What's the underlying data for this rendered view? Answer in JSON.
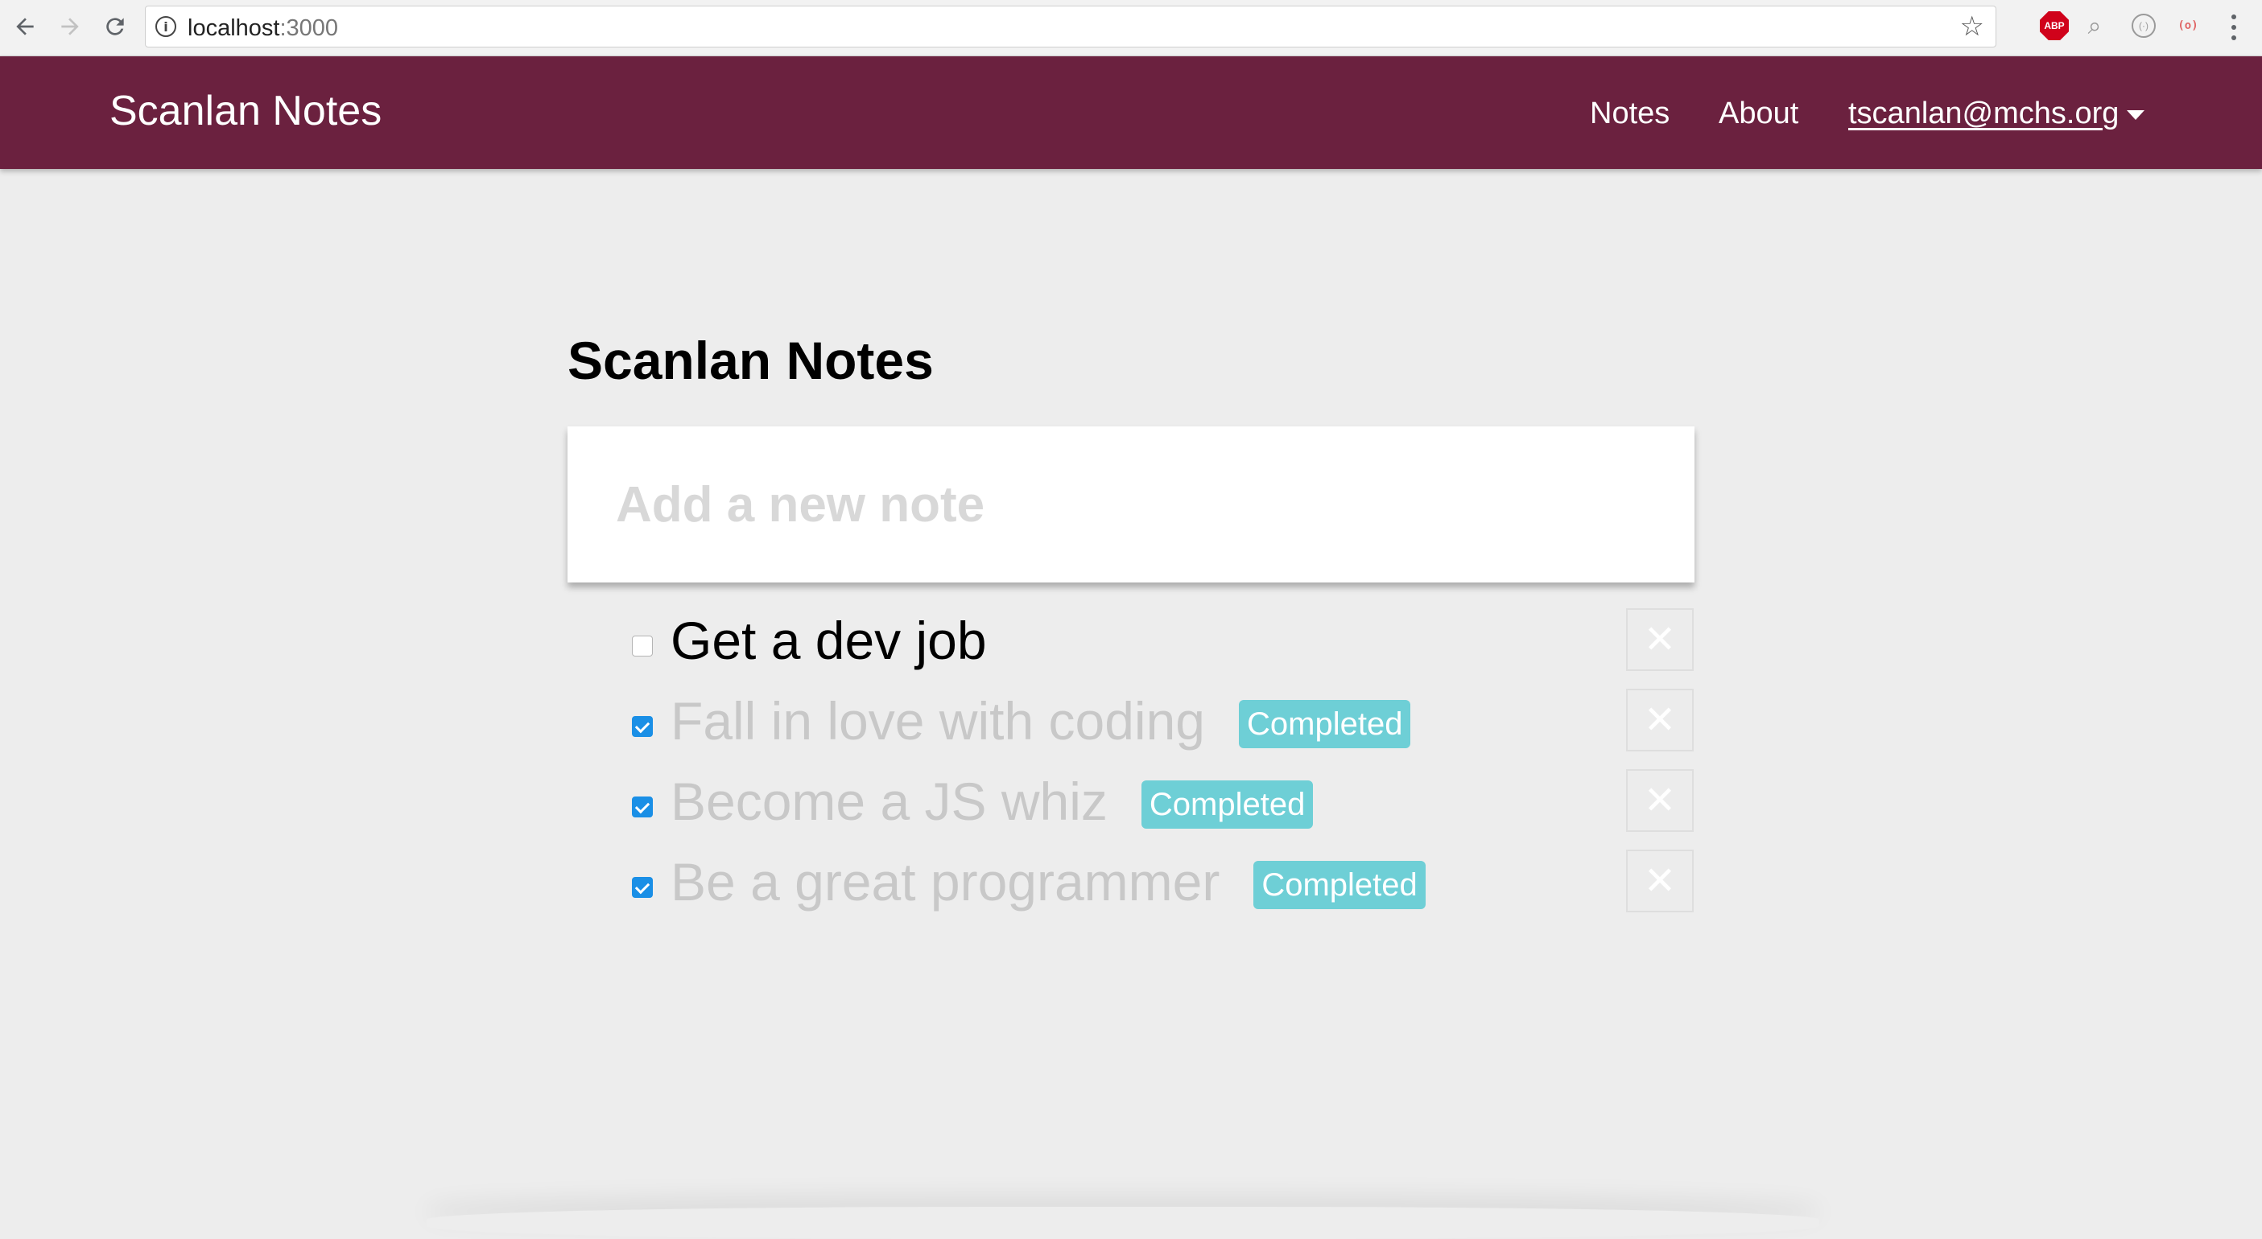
{
  "browser": {
    "url_host": "localhost",
    "url_port": ":3000",
    "extensions": [
      "abp-icon",
      "search-extension-icon",
      "circle-extension-icon",
      "cast-extension-icon"
    ],
    "abp_label": "ABP"
  },
  "navbar": {
    "brand": "Scanlan Notes",
    "links": [
      "Notes",
      "About"
    ],
    "user": "tscanlan@mchs.org",
    "background": "#6b213f"
  },
  "main": {
    "title": "Scanlan Notes",
    "new_note_placeholder": "Add a new note",
    "notes": [
      {
        "text": "Get a dev job",
        "completed": false,
        "badge": ""
      },
      {
        "text": "Fall in love with coding",
        "completed": true,
        "badge": "Completed"
      },
      {
        "text": "Become a JS whiz",
        "completed": true,
        "badge": "Completed"
      },
      {
        "text": "Be a great programmer",
        "completed": true,
        "badge": "Completed"
      }
    ],
    "delete_label": "✕"
  },
  "colors": {
    "accent": "#6b213f",
    "badge": "#6ecfd6",
    "checkbox": "#1a8fe6",
    "completed_text": "#c8c8c8"
  }
}
